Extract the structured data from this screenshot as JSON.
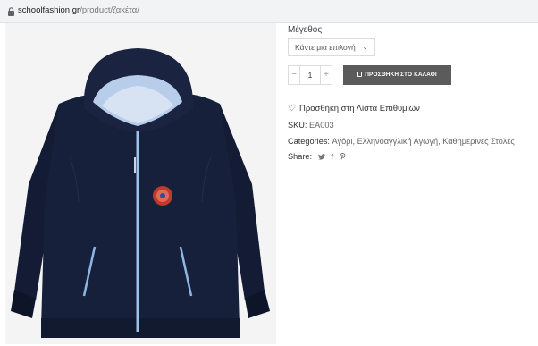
{
  "browser": {
    "url_domain": "schoolfashion.gr",
    "url_path": "/product/ζακέτα/"
  },
  "product": {
    "image_alt": "Ζακέτα",
    "size_label": "Μέγεθος",
    "size_select_value": "Κάντε μια επιλογή",
    "quantity": "1",
    "qty_minus": "−",
    "qty_plus": "+",
    "add_to_cart": "ΠΡΟΣΘΗΚΗ ΣΤΟ ΚΑΛΑΘΙ",
    "wishlist": "Προσθήκη στη Λίστα Επιθυμιών",
    "sku_label": "SKU:",
    "sku_value": "EA003",
    "categories_label": "Categories:",
    "categories": [
      "Αγόρι",
      "Ελληνοαγγλική Αγωγή",
      "Καθημερινές Στολές"
    ],
    "share_label": "Share:"
  },
  "icons": {
    "lock": "lock-icon",
    "heart": "heart-outline-icon",
    "twitter": "twitter-icon",
    "facebook": "facebook-icon",
    "pinterest": "pinterest-icon",
    "bag": "shopping-bag-icon"
  },
  "colors": {
    "button_bg": "#5b5b5b",
    "jacket": "#17203a",
    "zip": "#9cc4ea"
  }
}
